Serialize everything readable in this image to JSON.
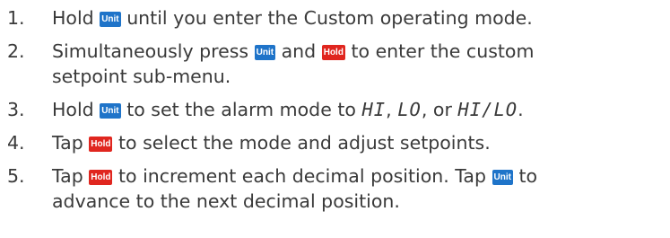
{
  "keys": {
    "unit": "Unit",
    "hold": "Hold"
  },
  "colors": {
    "unit_key": "#1f74c9",
    "hold_key": "#e0261f",
    "text": "#3a3a3a"
  },
  "steps": [
    {
      "num": "1.",
      "parts": [
        "Hold",
        "until you enter the Custom operating mode."
      ]
    },
    {
      "num": "2.",
      "parts": [
        "Simultaneously press",
        "and",
        "to enter the custom",
        "setpoint sub-menu."
      ]
    },
    {
      "num": "3.",
      "parts": [
        "Hold",
        "to set the alarm mode to",
        "HI",
        ",",
        "LO",
        ", or",
        "HI/LO",
        "."
      ]
    },
    {
      "num": "4.",
      "parts": [
        "Tap",
        "to select the mode and adjust setpoints."
      ]
    },
    {
      "num": "5.",
      "parts": [
        "Tap",
        "to increment each decimal position. Tap",
        "to",
        "advance to the next decimal position."
      ]
    }
  ]
}
